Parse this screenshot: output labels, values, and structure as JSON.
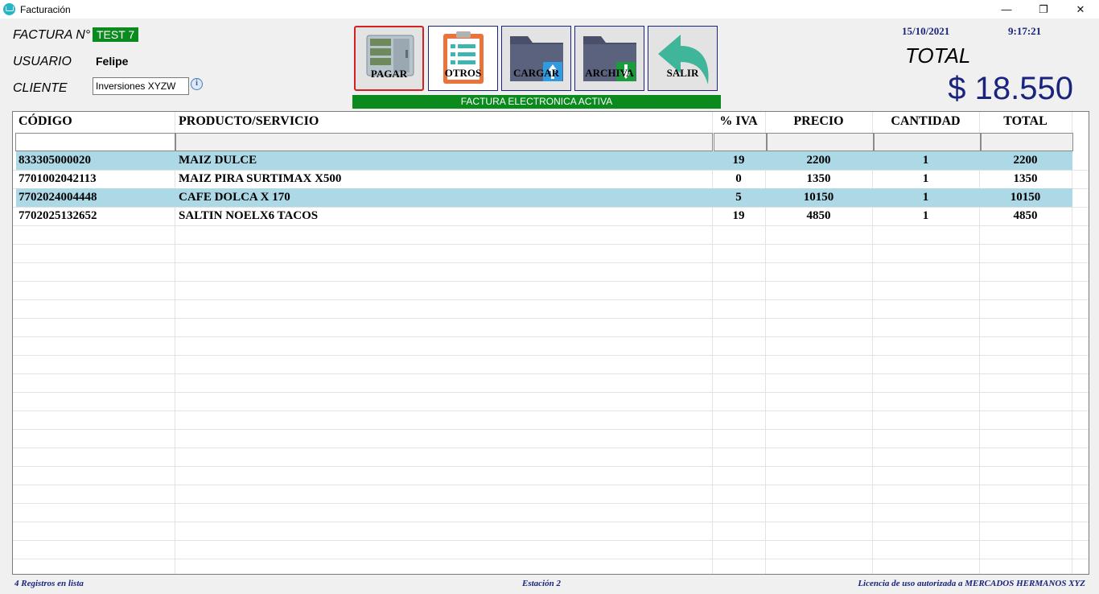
{
  "window": {
    "title": "Facturación",
    "minimize": "—",
    "maximize": "❐",
    "close": "✕"
  },
  "header": {
    "factura_label": "FACTURA N°",
    "factura_value": "TEST 7",
    "usuario_label": "USUARIO",
    "usuario_value": "Felipe",
    "cliente_label": "CLIENTE",
    "cliente_value": "Inversiones XYZW",
    "info_glyph": "i"
  },
  "toolbar": {
    "pagar": "PAGAR",
    "otros": "OTROS",
    "cargar": "CARGAR",
    "archiva": "ARCHIVA",
    "salir": "SALIR"
  },
  "banner": "FACTURA ELECTRONICA ACTIVA",
  "summary": {
    "date": "15/10/2021",
    "time": "9:17:21",
    "total_label": "TOTAL",
    "total_value": "$ 18.550"
  },
  "table": {
    "columns": [
      "CÓDIGO",
      "PRODUCTO/SERVICIO",
      "% IVA",
      "PRECIO",
      "CANTIDAD",
      "TOTAL"
    ],
    "rows": [
      [
        "833305000020",
        "MAIZ DULCE",
        "19",
        "2200",
        "1",
        "2200"
      ],
      [
        "7701002042113",
        "MAIZ PIRA SURTIMAX X500",
        "0",
        "1350",
        "1",
        "1350"
      ],
      [
        "7702024004448",
        "CAFE DOLCA X 170",
        "5",
        "10150",
        "1",
        "10150"
      ],
      [
        "7702025132652",
        "SALTIN NOELX6 TACOS",
        "19",
        "4850",
        "1",
        "4850"
      ]
    ]
  },
  "status": {
    "registros": "4 Registros en lista",
    "estacion": "Estación 2",
    "licencia": "Licencia de uso autorizada a MERCADOS HERMANOS XYZ"
  },
  "colors": {
    "accent_green": "#0b8a1e",
    "navy": "#1a237e",
    "row_highlight": "#add8e6"
  }
}
